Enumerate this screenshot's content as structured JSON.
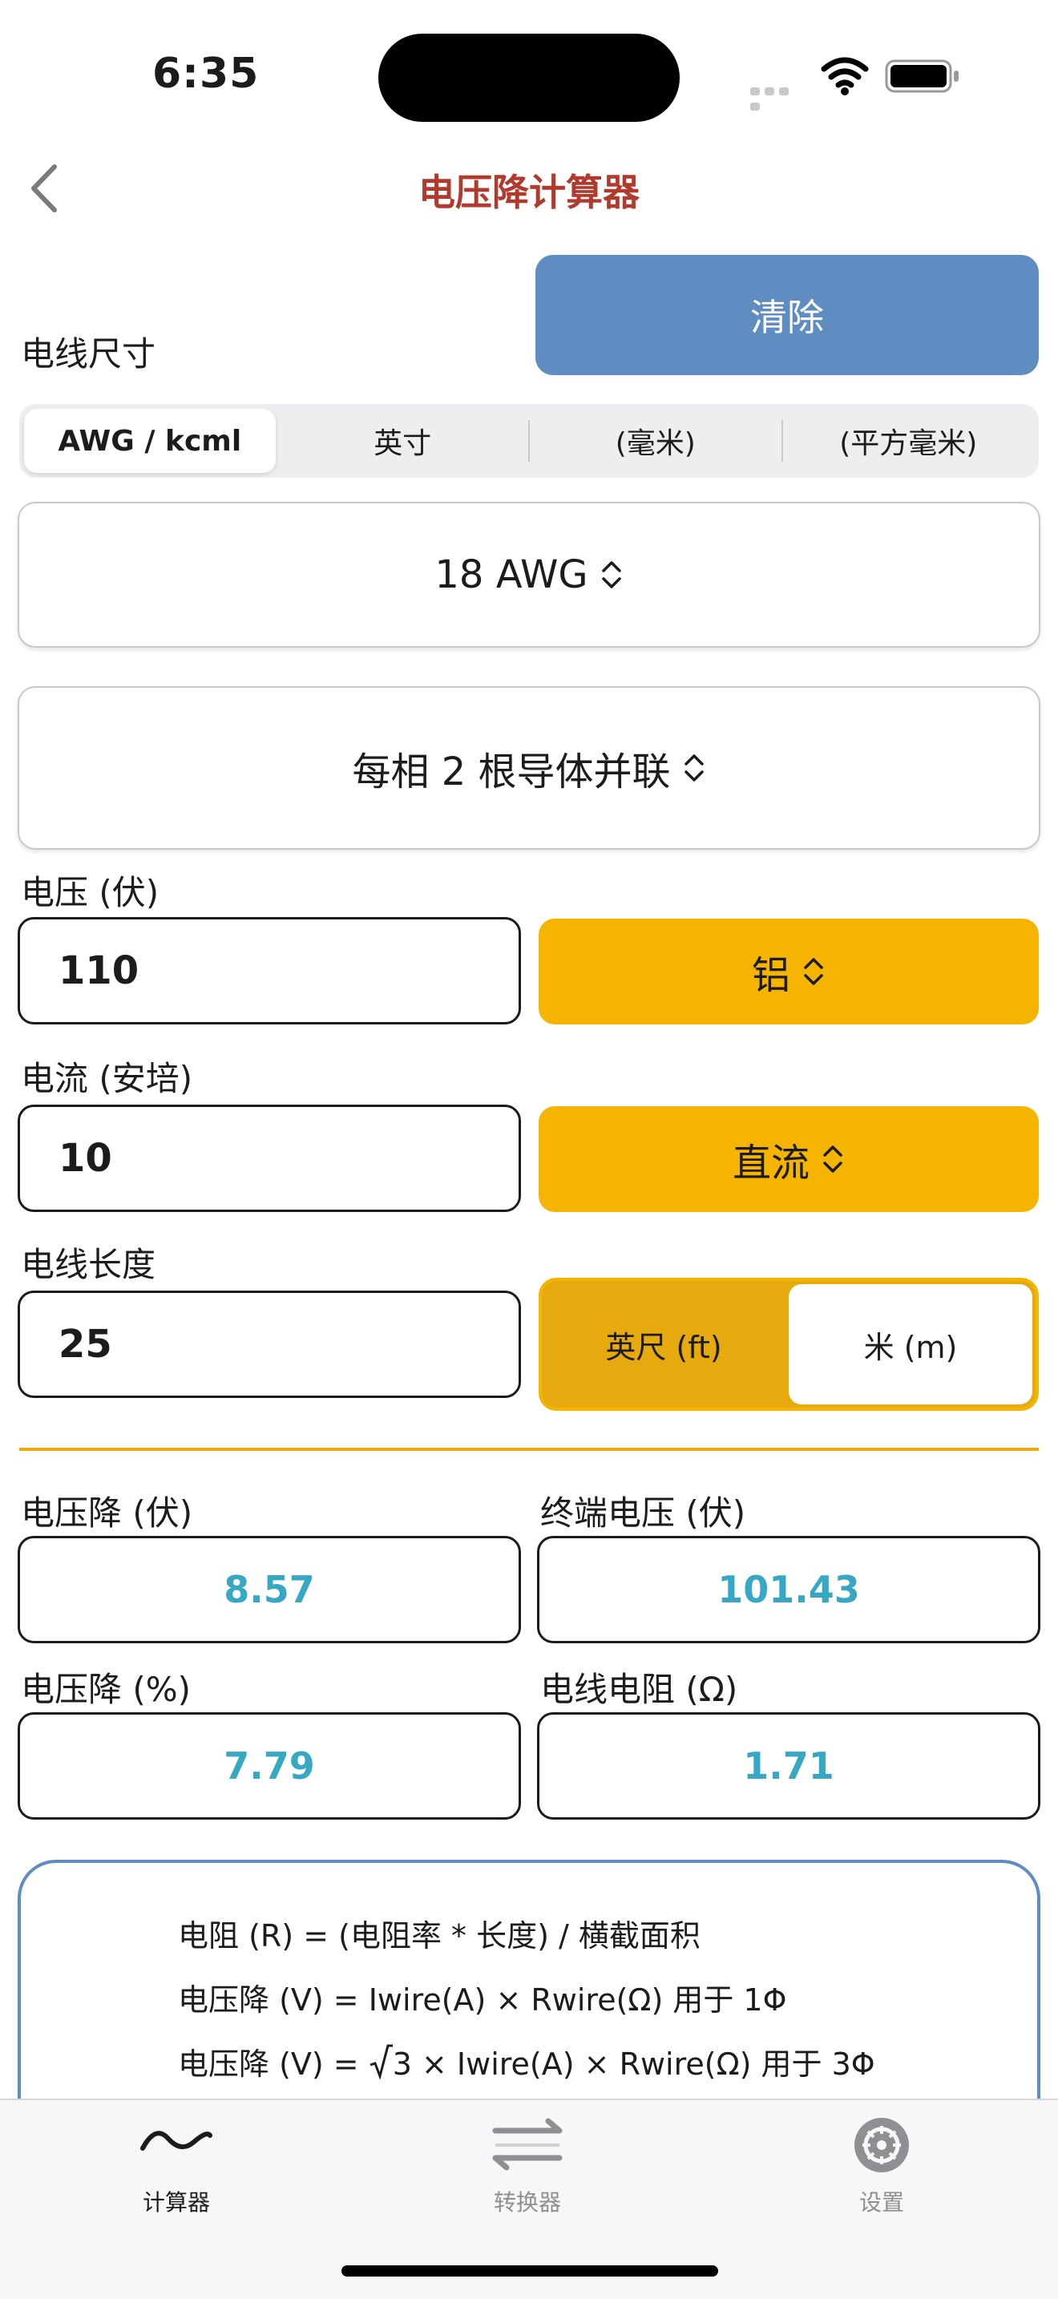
{
  "status": {
    "time": "6:35"
  },
  "nav": {
    "title": "电压降计算器"
  },
  "clear_label": "清除",
  "wire_size": {
    "label": "电线尺寸",
    "tabs": [
      "AWG / kcml",
      "英寸",
      "(毫米)",
      "(平方毫米)"
    ],
    "selected_tab": 0,
    "gauge": "18 AWG",
    "parallel": "每相 2 根导体并联"
  },
  "voltage": {
    "label": "电压 (伏)",
    "value": "110",
    "material": "铝"
  },
  "current": {
    "label": "电流 (安培)",
    "value": "10",
    "type": "直流"
  },
  "length": {
    "label": "电线长度",
    "value": "25",
    "units": [
      "英尺 (ft)",
      "米 (m)"
    ],
    "selected_unit": 1
  },
  "results": {
    "drop_v_label": "电压降 (伏)",
    "drop_v": "8.57",
    "end_v_label": "终端电压 (伏)",
    "end_v": "101.43",
    "drop_pct_label": "电压降 (%)",
    "drop_pct": "7.79",
    "resistance_label": "电线电阻 (Ω)",
    "resistance": "1.71"
  },
  "formulas": {
    "f1": "电阻 (R) = (电阻率 * 长度) / 横截面积",
    "f2": "电压降 (V) = Iwire(A) × Rwire(Ω) 用于 1Φ",
    "f3_pre": "电压降 (V) = ",
    "f3_post": "3 × Iwire(A) × Rwire(Ω) 用于 3Φ"
  },
  "tabbar": {
    "items": [
      {
        "label": "计算器",
        "icon": "sine-wave-icon",
        "color": "#1c1c1e"
      },
      {
        "label": "转换器",
        "icon": "swap-arrows-icon",
        "color": "#8e8e93"
      },
      {
        "label": "设置",
        "icon": "gear-icon",
        "color": "#8e8e93"
      }
    ]
  },
  "colors": {
    "accent_yellow": "#f4b400",
    "clear_blue": "#5f8dc1",
    "title_red": "#b03a2e",
    "result_cyan": "#37a8c4"
  }
}
